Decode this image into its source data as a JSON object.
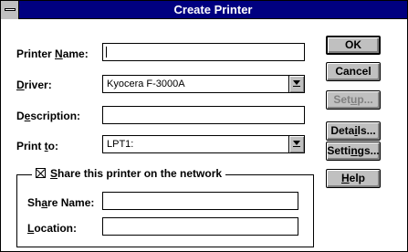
{
  "window": {
    "title": "Create Printer"
  },
  "form": {
    "printer_name": {
      "label_pre": "Printer ",
      "label_key": "N",
      "label_post": "ame:",
      "value": ""
    },
    "driver": {
      "label_pre": "",
      "label_key": "D",
      "label_post": "river:",
      "value": "Kyocera F-3000A"
    },
    "description": {
      "label_pre": "D",
      "label_key": "e",
      "label_post": "scription:",
      "value": ""
    },
    "print_to": {
      "label_pre": "Print ",
      "label_key": "t",
      "label_post": "o:",
      "value": "LPT1:"
    }
  },
  "share": {
    "checkbox_pre": "",
    "checkbox_key": "S",
    "checkbox_post": "hare this printer on the network",
    "checked": true,
    "share_name": {
      "label_pre": "Sh",
      "label_key": "a",
      "label_post": "re Name:",
      "value": ""
    },
    "location": {
      "label_pre": "",
      "label_key": "L",
      "label_post": "ocation:",
      "value": ""
    }
  },
  "buttons": {
    "ok": {
      "pre": "OK",
      "key": "",
      "post": ""
    },
    "cancel": {
      "pre": "Cancel",
      "key": "",
      "post": ""
    },
    "setup": {
      "pre": "Set",
      "key": "u",
      "post": "p..."
    },
    "details": {
      "pre": "Deta",
      "key": "i",
      "post": "ls..."
    },
    "settings": {
      "pre": "Setti",
      "key": "n",
      "post": "gs..."
    },
    "help": {
      "pre": "",
      "key": "H",
      "post": "elp"
    }
  },
  "colors": {
    "titlebar": "#000080",
    "button_face": "#c0c0c0",
    "disabled_text": "#808080"
  }
}
